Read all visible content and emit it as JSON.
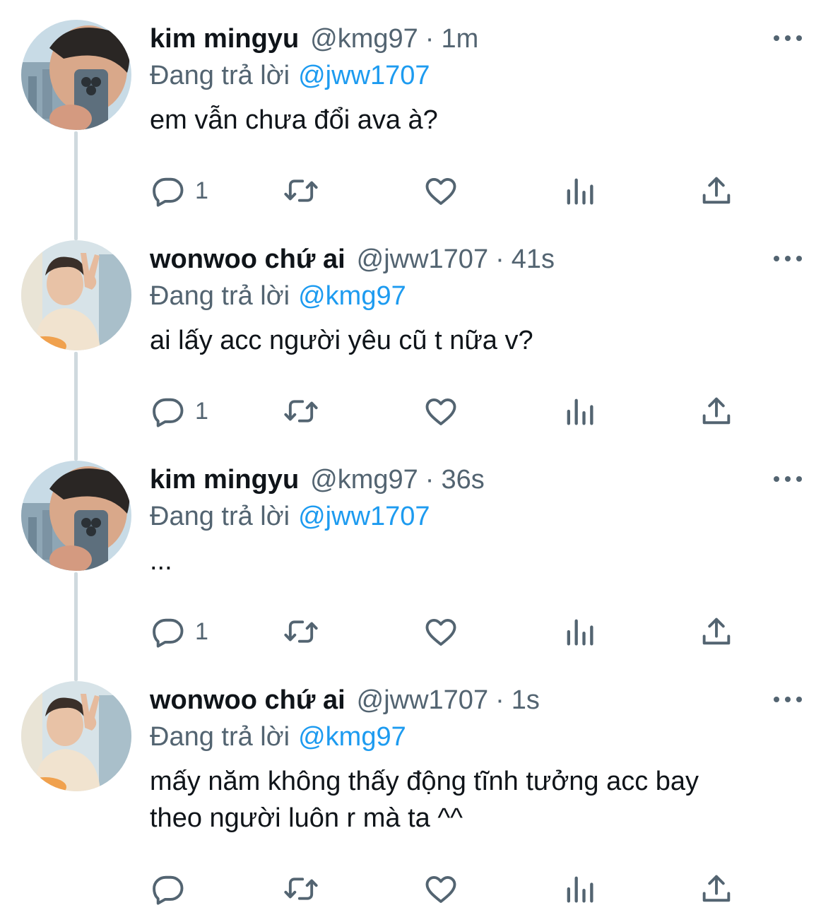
{
  "reply_prefix": "Đang trả lời",
  "icons": {
    "reply": "reply-icon",
    "retweet": "retweet-icon",
    "like": "like-icon",
    "views": "views-icon",
    "share": "share-icon",
    "more": "more-icon"
  },
  "colors": {
    "text": "#0f1419",
    "secondary": "#536471",
    "mention": "#1d9bf0",
    "thread_line": "#cfd9de"
  },
  "tweets": [
    {
      "name": "kim mingyu",
      "handle": "@kmg97",
      "separator": "·",
      "time": "1m",
      "reply_to": "@jww1707",
      "lines": [
        "em vẫn chưa đổi ava à?"
      ],
      "reply_count": "1",
      "avatar": "mingyu-avatar"
    },
    {
      "name": "wonwoo chứ ai",
      "handle": "@jww1707",
      "separator": "·",
      "time": "41s",
      "reply_to": "@kmg97",
      "lines": [
        "ai lấy acc người yêu cũ t nữa v?"
      ],
      "reply_count": "1",
      "avatar": "wonwoo-avatar"
    },
    {
      "name": "kim mingyu",
      "handle": "@kmg97",
      "separator": "·",
      "time": "36s",
      "reply_to": "@jww1707",
      "lines": [
        "..."
      ],
      "reply_count": "1",
      "avatar": "mingyu-avatar"
    },
    {
      "name": "wonwoo chứ ai",
      "handle": "@jww1707",
      "separator": "·",
      "time": "1s",
      "reply_to": "@kmg97",
      "lines": [
        "mấy năm không thấy động tĩnh tưởng acc bay",
        "theo người luôn r mà ta ^^"
      ],
      "reply_count": "",
      "avatar": "wonwoo-avatar"
    }
  ]
}
